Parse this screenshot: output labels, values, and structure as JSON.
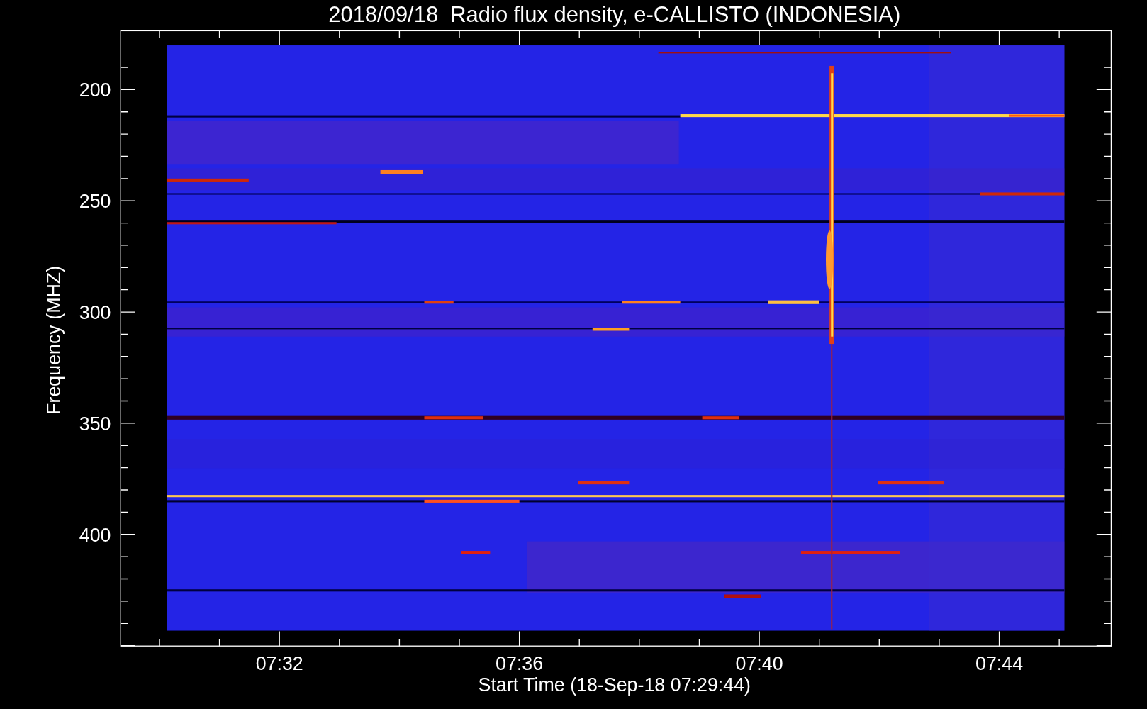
{
  "title": "2018/09/18  Radio flux density, e-CALLISTO (INDONESIA)",
  "ylabel": "Frequency (MHZ)",
  "xlabel": "Start Time (18-Sep-18 07:29:44)",
  "yticks": [
    "200",
    "250",
    "300",
    "350",
    "400"
  ],
  "xticks": [
    "07:32",
    "07:36",
    "07:40",
    "07:44"
  ]
}
